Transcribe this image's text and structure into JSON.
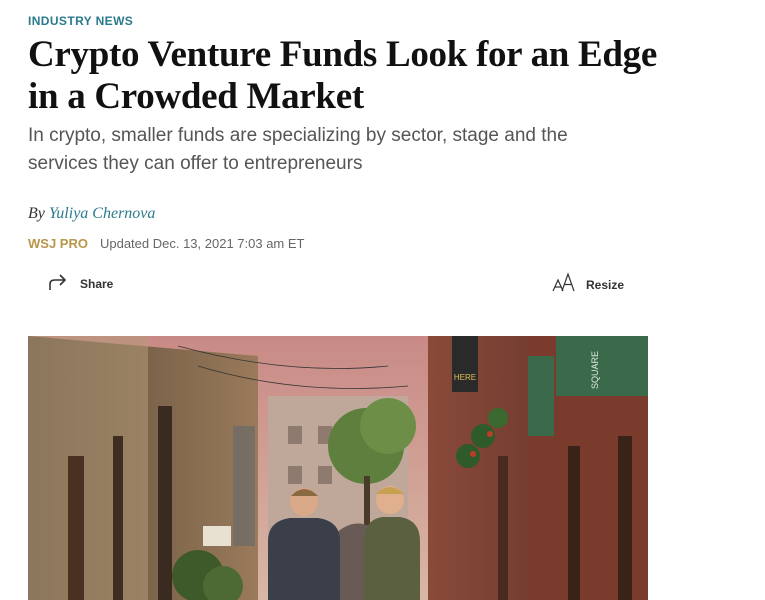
{
  "article": {
    "kicker": "INDUSTRY NEWS",
    "headline": "Crypto Venture Funds Look for an Edge in a Crowded Market",
    "dek": "In crypto, smaller funds are specializing by sector, stage and the services they can offer to entrepreneurs",
    "byline_prefix": "By",
    "author": "Yuliya Chernova",
    "source": "WSJ PRO",
    "updated": "Updated Dec. 13, 2021 7:03 am ET"
  },
  "tools": {
    "share_label": "Share",
    "resize_label": "Resize",
    "resize_glyph": "AA"
  },
  "photo": {
    "sign_text": "HERE",
    "green_sign": "SQUARE"
  },
  "colors": {
    "accent": "#2b7a8c",
    "source": "#b8964a"
  }
}
